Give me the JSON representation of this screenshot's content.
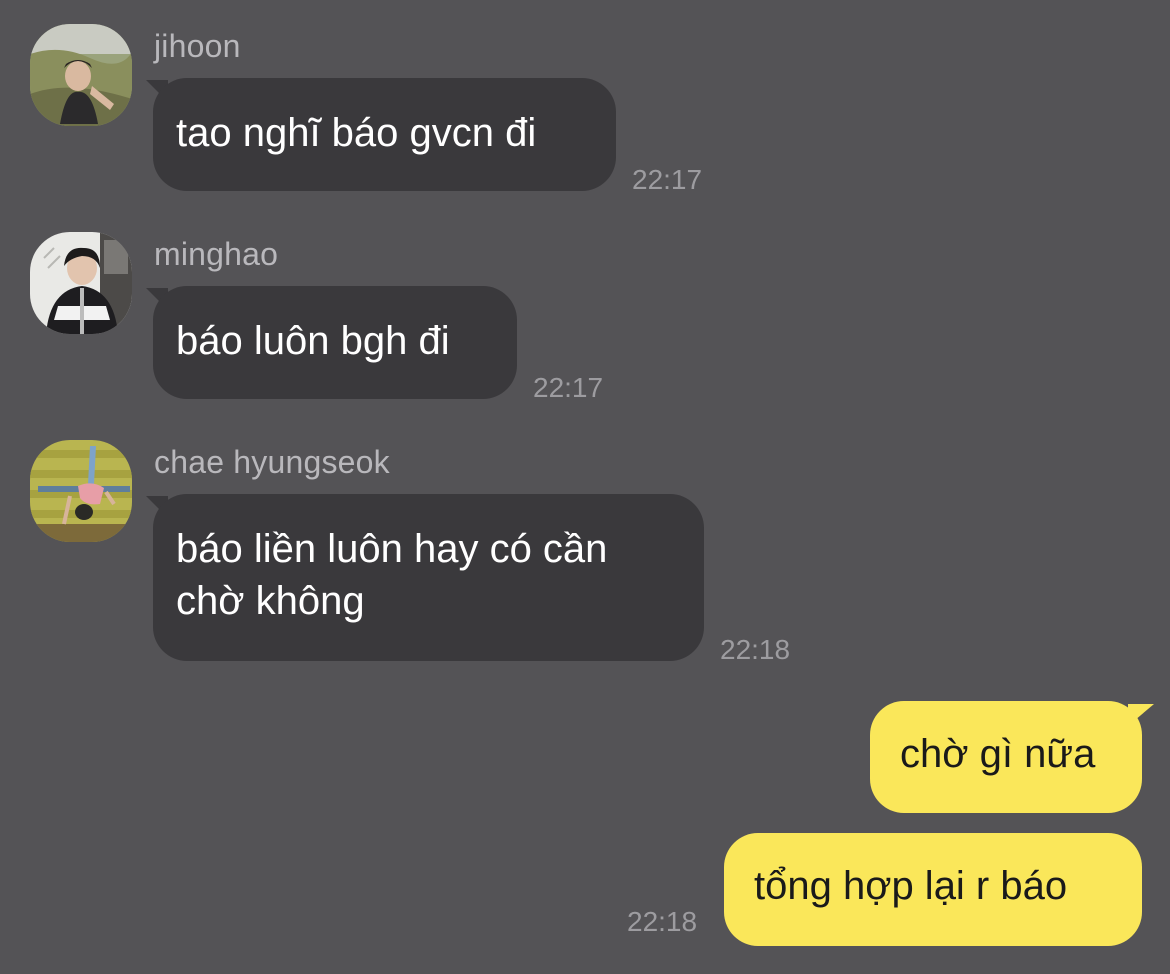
{
  "messages": [
    {
      "sender": "jihoon",
      "avatar": "jihoon-avatar",
      "text": "tao nghĩ báo gvcn đi",
      "time": "22:17"
    },
    {
      "sender": "minghao",
      "avatar": "minghao-avatar",
      "text": "báo luôn bgh đi",
      "time": "22:17"
    },
    {
      "sender": "chae hyungseok",
      "avatar": "chae-hyungseok-avatar",
      "lines": [
        "báo liền luôn hay có cần",
        "chờ không"
      ],
      "time": "22:18"
    }
  ],
  "outgoing": [
    {
      "text": "chờ gì nữa"
    },
    {
      "text": "tổng hợp lại r báo",
      "time": "22:18"
    }
  ],
  "colors": {
    "background": "#545356",
    "incoming_bubble": "#3a393c",
    "outgoing_bubble": "#fae75a",
    "timestamp": "#9d9ca0",
    "sender_name": "#b9b8bc"
  }
}
